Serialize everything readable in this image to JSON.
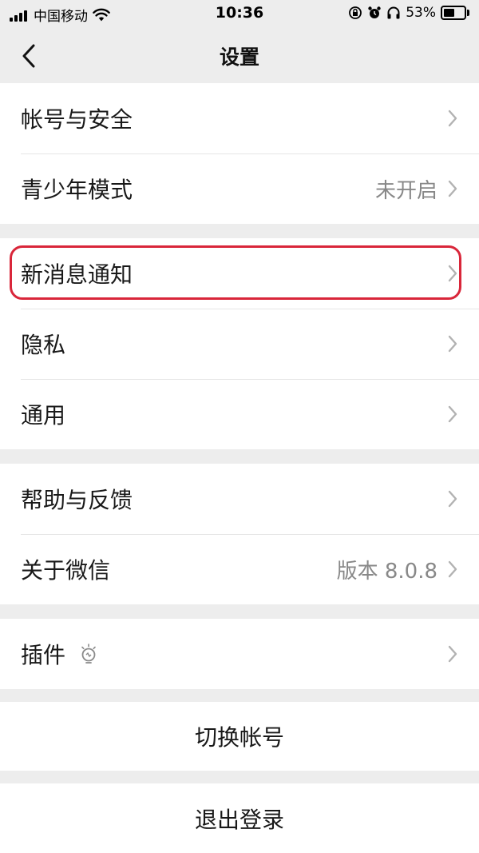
{
  "status_bar": {
    "carrier": "中国移动",
    "time": "10:36",
    "battery": "53%",
    "battery_level": 0.53,
    "icons": [
      "signal-icon",
      "wifi-icon",
      "rotation-lock-icon",
      "alarm-icon",
      "headphones-icon",
      "battery-icon"
    ]
  },
  "nav": {
    "title": "设置",
    "back_icon": "chevron-left-icon"
  },
  "groups": {
    "account": {
      "account_security": {
        "label": "帐号与安全"
      },
      "teen_mode": {
        "label": "青少年模式",
        "value": "未开启"
      }
    },
    "notify": {
      "new_message": {
        "label": "新消息通知"
      },
      "privacy": {
        "label": "隐私"
      },
      "general": {
        "label": "通用"
      }
    },
    "about": {
      "help": {
        "label": "帮助与反馈"
      },
      "about_wechat": {
        "label": "关于微信",
        "value": "版本 8.0.8"
      }
    },
    "plugins": {
      "label": "插件",
      "icon": "lightbulb-icon"
    }
  },
  "actions": {
    "switch_account": "切换帐号",
    "logout": "退出登录"
  },
  "colors": {
    "background": "#ededed",
    "card": "#ffffff",
    "highlight": "#d9263a",
    "secondary_text": "#888888"
  }
}
